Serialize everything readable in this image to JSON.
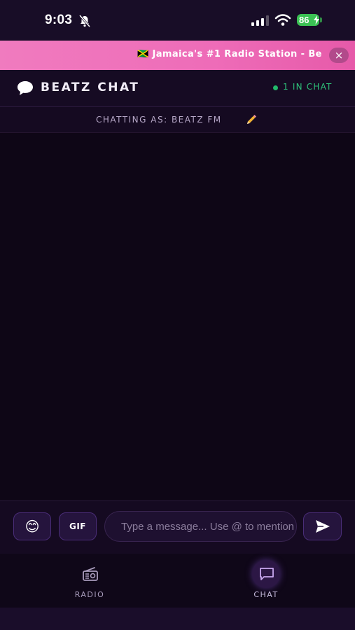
{
  "status_bar": {
    "time": "9:03",
    "battery": "86",
    "icons": [
      "bell-off-icon",
      "signal-icon",
      "wifi-icon",
      "battery-icon"
    ]
  },
  "banner": {
    "text": "🇯🇲 Jamaica's #1 Radio Station - Be",
    "close_label": "×"
  },
  "header": {
    "title": "BEATZ CHAT",
    "online_count": "1 IN CHAT",
    "online_color": "#22b96a"
  },
  "chatting_as": {
    "text": "CHATTING AS: BEATZ FM"
  },
  "composer": {
    "emoji_label": "😊",
    "gif_label": "GIF",
    "input_placeholder": "Type a message... Use @ to mention",
    "input_value": ""
  },
  "bottom_nav": {
    "items": [
      {
        "label": "RADIO",
        "icon": "radio-icon",
        "active": false
      },
      {
        "label": "CHAT",
        "icon": "chat-icon",
        "active": true
      }
    ]
  },
  "colors": {
    "accent": "#6b3fb0",
    "banner": "#ee6cb8",
    "background": "#0d0614"
  }
}
